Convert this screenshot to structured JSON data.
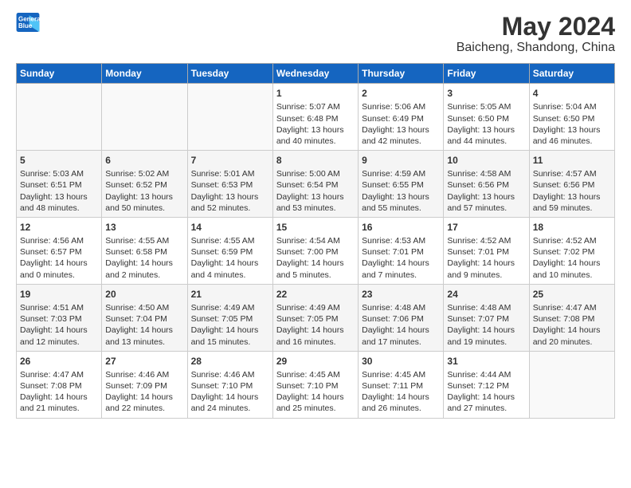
{
  "logo": {
    "line1": "General",
    "line2": "Blue"
  },
  "title": "May 2024",
  "subtitle": "Baicheng, Shandong, China",
  "days_of_week": [
    "Sunday",
    "Monday",
    "Tuesday",
    "Wednesday",
    "Thursday",
    "Friday",
    "Saturday"
  ],
  "weeks": [
    [
      {
        "day": "",
        "content": ""
      },
      {
        "day": "",
        "content": ""
      },
      {
        "day": "",
        "content": ""
      },
      {
        "day": "1",
        "content": "Sunrise: 5:07 AM\nSunset: 6:48 PM\nDaylight: 13 hours\nand 40 minutes."
      },
      {
        "day": "2",
        "content": "Sunrise: 5:06 AM\nSunset: 6:49 PM\nDaylight: 13 hours\nand 42 minutes."
      },
      {
        "day": "3",
        "content": "Sunrise: 5:05 AM\nSunset: 6:50 PM\nDaylight: 13 hours\nand 44 minutes."
      },
      {
        "day": "4",
        "content": "Sunrise: 5:04 AM\nSunset: 6:50 PM\nDaylight: 13 hours\nand 46 minutes."
      }
    ],
    [
      {
        "day": "5",
        "content": "Sunrise: 5:03 AM\nSunset: 6:51 PM\nDaylight: 13 hours\nand 48 minutes."
      },
      {
        "day": "6",
        "content": "Sunrise: 5:02 AM\nSunset: 6:52 PM\nDaylight: 13 hours\nand 50 minutes."
      },
      {
        "day": "7",
        "content": "Sunrise: 5:01 AM\nSunset: 6:53 PM\nDaylight: 13 hours\nand 52 minutes."
      },
      {
        "day": "8",
        "content": "Sunrise: 5:00 AM\nSunset: 6:54 PM\nDaylight: 13 hours\nand 53 minutes."
      },
      {
        "day": "9",
        "content": "Sunrise: 4:59 AM\nSunset: 6:55 PM\nDaylight: 13 hours\nand 55 minutes."
      },
      {
        "day": "10",
        "content": "Sunrise: 4:58 AM\nSunset: 6:56 PM\nDaylight: 13 hours\nand 57 minutes."
      },
      {
        "day": "11",
        "content": "Sunrise: 4:57 AM\nSunset: 6:56 PM\nDaylight: 13 hours\nand 59 minutes."
      }
    ],
    [
      {
        "day": "12",
        "content": "Sunrise: 4:56 AM\nSunset: 6:57 PM\nDaylight: 14 hours\nand 0 minutes."
      },
      {
        "day": "13",
        "content": "Sunrise: 4:55 AM\nSunset: 6:58 PM\nDaylight: 14 hours\nand 2 minutes."
      },
      {
        "day": "14",
        "content": "Sunrise: 4:55 AM\nSunset: 6:59 PM\nDaylight: 14 hours\nand 4 minutes."
      },
      {
        "day": "15",
        "content": "Sunrise: 4:54 AM\nSunset: 7:00 PM\nDaylight: 14 hours\nand 5 minutes."
      },
      {
        "day": "16",
        "content": "Sunrise: 4:53 AM\nSunset: 7:01 PM\nDaylight: 14 hours\nand 7 minutes."
      },
      {
        "day": "17",
        "content": "Sunrise: 4:52 AM\nSunset: 7:01 PM\nDaylight: 14 hours\nand 9 minutes."
      },
      {
        "day": "18",
        "content": "Sunrise: 4:52 AM\nSunset: 7:02 PM\nDaylight: 14 hours\nand 10 minutes."
      }
    ],
    [
      {
        "day": "19",
        "content": "Sunrise: 4:51 AM\nSunset: 7:03 PM\nDaylight: 14 hours\nand 12 minutes."
      },
      {
        "day": "20",
        "content": "Sunrise: 4:50 AM\nSunset: 7:04 PM\nDaylight: 14 hours\nand 13 minutes."
      },
      {
        "day": "21",
        "content": "Sunrise: 4:49 AM\nSunset: 7:05 PM\nDaylight: 14 hours\nand 15 minutes."
      },
      {
        "day": "22",
        "content": "Sunrise: 4:49 AM\nSunset: 7:05 PM\nDaylight: 14 hours\nand 16 minutes."
      },
      {
        "day": "23",
        "content": "Sunrise: 4:48 AM\nSunset: 7:06 PM\nDaylight: 14 hours\nand 17 minutes."
      },
      {
        "day": "24",
        "content": "Sunrise: 4:48 AM\nSunset: 7:07 PM\nDaylight: 14 hours\nand 19 minutes."
      },
      {
        "day": "25",
        "content": "Sunrise: 4:47 AM\nSunset: 7:08 PM\nDaylight: 14 hours\nand 20 minutes."
      }
    ],
    [
      {
        "day": "26",
        "content": "Sunrise: 4:47 AM\nSunset: 7:08 PM\nDaylight: 14 hours\nand 21 minutes."
      },
      {
        "day": "27",
        "content": "Sunrise: 4:46 AM\nSunset: 7:09 PM\nDaylight: 14 hours\nand 22 minutes."
      },
      {
        "day": "28",
        "content": "Sunrise: 4:46 AM\nSunset: 7:10 PM\nDaylight: 14 hours\nand 24 minutes."
      },
      {
        "day": "29",
        "content": "Sunrise: 4:45 AM\nSunset: 7:10 PM\nDaylight: 14 hours\nand 25 minutes."
      },
      {
        "day": "30",
        "content": "Sunrise: 4:45 AM\nSunset: 7:11 PM\nDaylight: 14 hours\nand 26 minutes."
      },
      {
        "day": "31",
        "content": "Sunrise: 4:44 AM\nSunset: 7:12 PM\nDaylight: 14 hours\nand 27 minutes."
      },
      {
        "day": "",
        "content": ""
      }
    ]
  ]
}
